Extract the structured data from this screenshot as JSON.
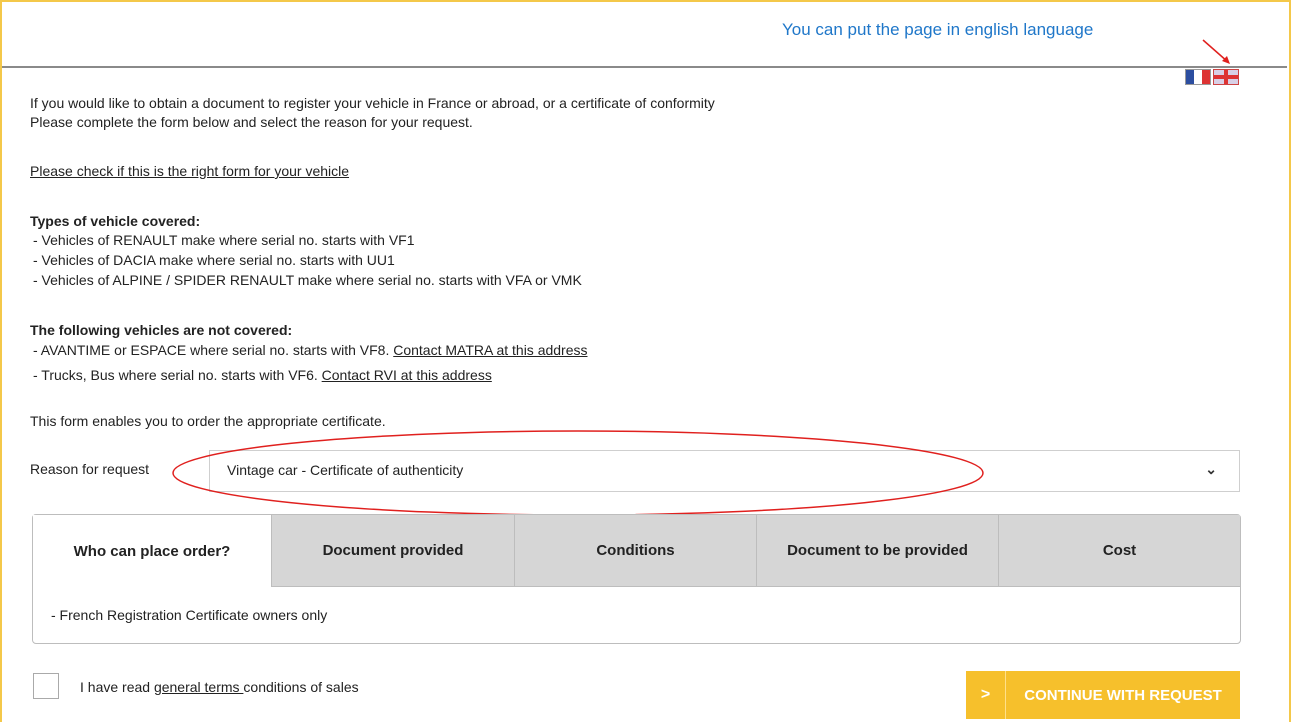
{
  "header": {
    "hint_text": "You can put the page in english language",
    "hint_color": "#1f77c9",
    "languages": [
      {
        "code": "fr",
        "icon": "french-flag-icon"
      },
      {
        "code": "en",
        "icon": "english-flag-icon"
      }
    ]
  },
  "intro": {
    "line1": "If you would like to obtain a document to register your vehicle in France or abroad, or a certificate of conformity",
    "line2": "Please complete the form below and select the reason for your request.",
    "check_link": "Please check if this is the right form for your vehicle"
  },
  "covered": {
    "title": "Types of vehicle covered:",
    "items": [
      "- Vehicles of RENAULT make where serial no. starts with VF1",
      "- Vehicles of DACIA make where serial no. starts with UU1",
      "- Vehicles of ALPINE / SPIDER RENAULT make where serial no. starts with VFA or VMK"
    ]
  },
  "not_covered": {
    "title": "The following vehicles are not covered:",
    "items": [
      {
        "text": "- AVANTIME or ESPACE where serial no. starts with VF8. ",
        "link": "Contact MATRA at this address"
      },
      {
        "text": "- Trucks, Bus where serial no. starts with VF6. ",
        "link": "Contact RVI at this address"
      }
    ]
  },
  "form_note": "This form enables you to order the appropriate certificate.",
  "reason": {
    "label": "Reason for request",
    "selected": "Vintage car - Certificate of authenticity"
  },
  "tabs": [
    {
      "label": "Who can place order?",
      "active": true
    },
    {
      "label": "Document provided",
      "active": false
    },
    {
      "label": "Conditions",
      "active": false
    },
    {
      "label": "Document to be provided",
      "active": false
    },
    {
      "label": "Cost",
      "active": false
    }
  ],
  "tab_content": "- French Registration Certificate owners only",
  "terms": {
    "prefix": "I have read ",
    "link": "general terms ",
    "suffix": "conditions of sales",
    "checked": false
  },
  "continue_button": {
    "arrow": ">",
    "label": "CONTINUE WITH REQUEST",
    "color": "#f6c02c"
  },
  "annotation_color": "#e0201e"
}
